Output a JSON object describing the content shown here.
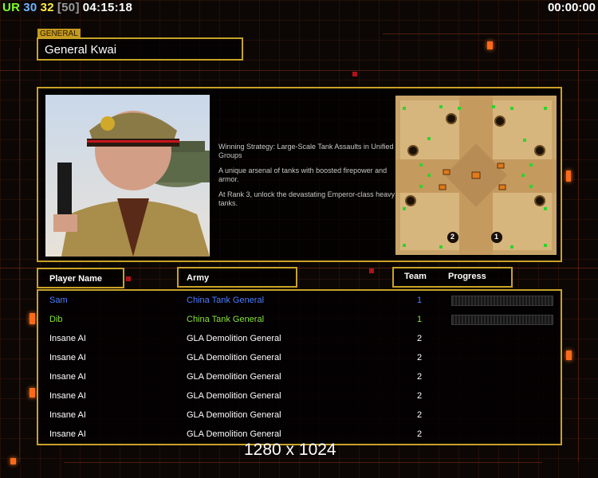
{
  "topbar": {
    "ur": "UR",
    "v1": "30",
    "v2": "32",
    "v3": "[50]",
    "clock": "04:15:18",
    "timer": "00:00:00"
  },
  "general": {
    "tag": "GENERAL",
    "name": "General Kwai"
  },
  "description": [
    "Winning Strategy: Large-Scale Tank Assaults in Unified Groups",
    "A unique arsenal of tanks with boosted firepower and armor.",
    "At Rank 3, unlock the devastating Emperor-class heavy tanks."
  ],
  "headers": {
    "player_name": "Player Name",
    "army": "Army",
    "team": "Team",
    "progress": "Progress"
  },
  "players": [
    {
      "name": "Sam",
      "army": "China Tank General",
      "team": "1",
      "color": "#4d7dff",
      "progress_visible": true
    },
    {
      "name": "Dib",
      "army": "China Tank General",
      "team": "1",
      "color": "#88e23a",
      "progress_visible": true
    },
    {
      "name": "Insane AI",
      "army": "GLA Demolition General",
      "team": "2",
      "color": "#ffffff",
      "progress_visible": false
    },
    {
      "name": "Insane AI",
      "army": "GLA Demolition General",
      "team": "2",
      "color": "#ffffff",
      "progress_visible": false
    },
    {
      "name": "Insane AI",
      "army": "GLA Demolition General",
      "team": "2",
      "color": "#ffffff",
      "progress_visible": false
    },
    {
      "name": "Insane AI",
      "army": "GLA Demolition General",
      "team": "2",
      "color": "#ffffff",
      "progress_visible": false
    },
    {
      "name": "Insane AI",
      "army": "GLA Demolition General",
      "team": "2",
      "color": "#ffffff",
      "progress_visible": false
    },
    {
      "name": "Insane AI",
      "army": "GLA Demolition General",
      "team": "2",
      "color": "#ffffff",
      "progress_visible": false
    }
  ],
  "minimap": {
    "start_labels": [
      "2",
      "1"
    ]
  },
  "caption": "1280 x 1024",
  "colors": {
    "accent": "#c9a227",
    "background": "#0c0705"
  }
}
